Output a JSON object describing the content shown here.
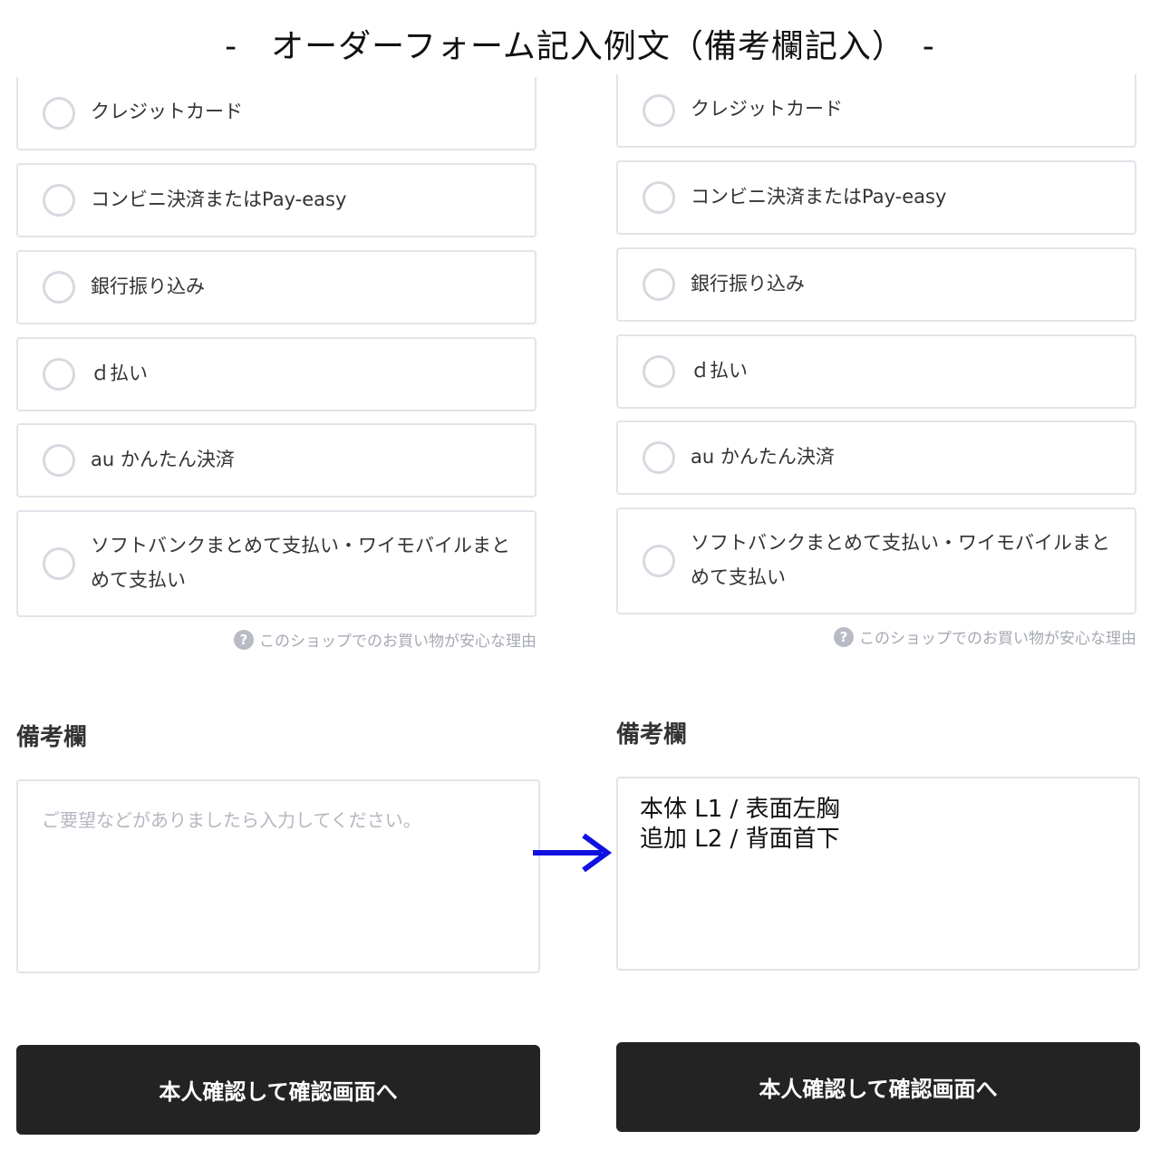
{
  "page_title": "-　オーダーフォーム記入例文（備考欄記入）　-",
  "panels": {
    "left": {
      "payment_options": [
        "クレジットカード",
        "コンビニ決済またはPay-easy",
        "銀行振り込み",
        "ｄ払い",
        "au かんたん決済",
        "ソフトバンクまとめて支払い・ワイモバイルまとめて支払い"
      ],
      "reason_link": "このショップでのお買い物が安心な理由",
      "remarks_heading": "備考欄",
      "remarks_placeholder": "ご要望などがありましたら入力してください。",
      "confirm_button": "本人確認して確認画面へ"
    },
    "right": {
      "payment_options": [
        "クレジットカード",
        "コンビニ決済またはPay-easy",
        "銀行振り込み",
        "ｄ払い",
        "au かんたん決済",
        "ソフトバンクまとめて支払い・ワイモバイルまとめて支払い"
      ],
      "reason_link": "このショップでのお買い物が安心な理由",
      "remarks_heading": "備考欄",
      "remarks_lines": [
        "本体 L1 / 表面左胸",
        "追加 L2 / 背面首下"
      ],
      "confirm_button": "本人確認して確認画面へ"
    }
  },
  "icons": {
    "help": "question-circle-icon",
    "arrow": "right-arrow-icon"
  },
  "help_glyph": "?",
  "colors": {
    "button_bg": "#232323",
    "border": "#e3e4ea",
    "arrow": "#1010e0",
    "muted_text": "#a6a9b3"
  }
}
